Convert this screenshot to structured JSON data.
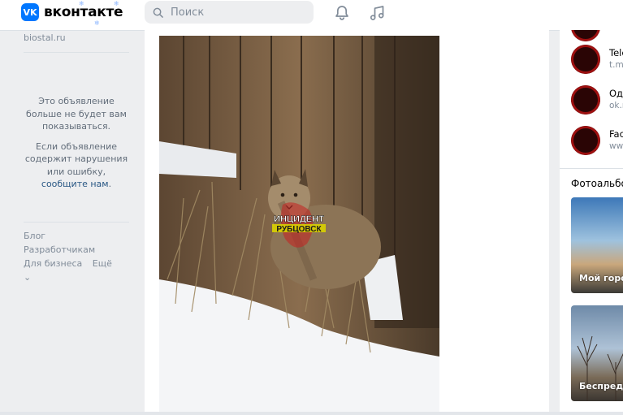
{
  "header": {
    "logo_text": "вконтакте",
    "logo_mark": "VK",
    "search_placeholder": "Поиск",
    "icons": [
      "bell-icon",
      "music-note-icon",
      "search-icon"
    ]
  },
  "left": {
    "ad_site": "biostal.ru",
    "ad_hidden_text": "Это объявление больше не будет вам показываться.",
    "ad_report_text": "Если объявление содержит нарушения или ошибку,",
    "ad_report_link": "сообщите нам",
    "ad_report_end": ".",
    "footer": {
      "blog": "Блог",
      "developers": "Разработчикам",
      "business": "Для бизнеса",
      "more": "Ещё"
    }
  },
  "post": {
    "watermark_line1": "ИНЦИДЕНТ",
    "watermark_line2": "РУБЦОВСК"
  },
  "right": {
    "communities": [
      {
        "name": "Tele",
        "sub": "t.me"
      },
      {
        "name": "Одн",
        "sub": "ok.r"
      },
      {
        "name": "Fac",
        "sub": "www"
      }
    ],
    "photos_title": "Фотоальбом",
    "albums": [
      {
        "label": "Мой город"
      },
      {
        "label": "Беспредел"
      }
    ]
  },
  "colors": {
    "accent": "#0077ff",
    "link": "#2a5885",
    "muted": "#818c99",
    "background": "#edeef0"
  }
}
